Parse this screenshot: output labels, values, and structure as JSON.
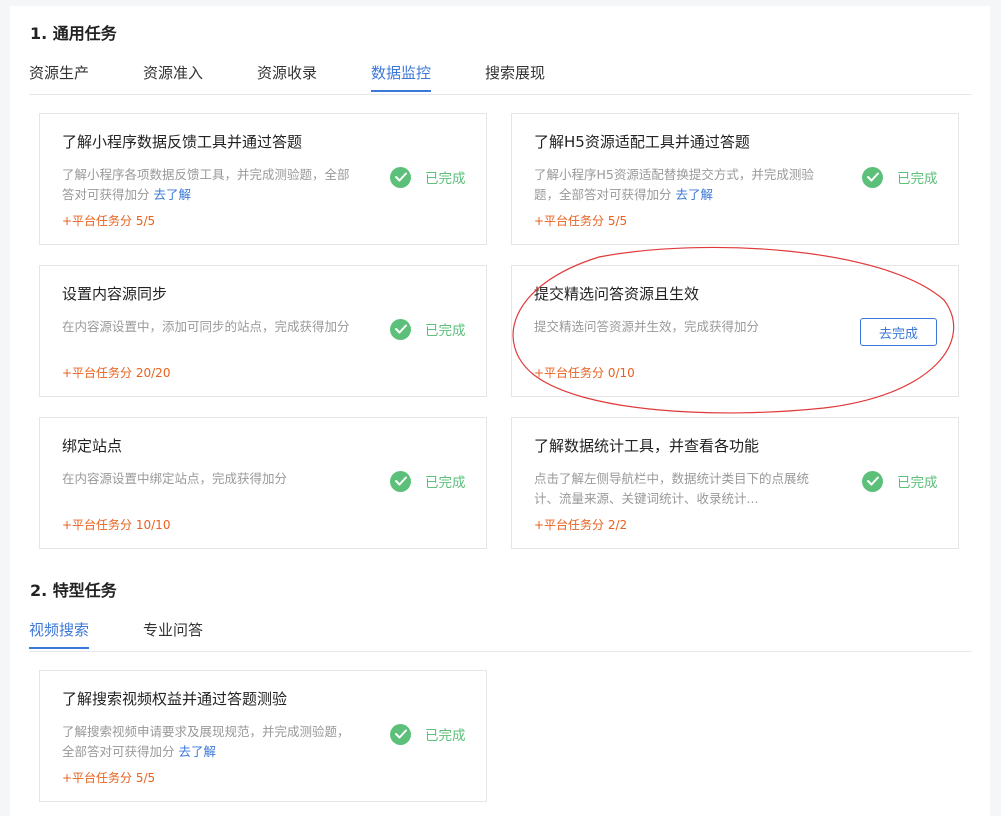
{
  "section1": {
    "title": "1. 通用任务",
    "tabs": [
      "资源生产",
      "资源准入",
      "资源收录",
      "数据监控",
      "搜索展现"
    ],
    "active_tab": "数据监控"
  },
  "section2": {
    "title": "2. 特型任务",
    "tabs": [
      "视频搜索",
      "专业问答"
    ],
    "active_tab": "视频搜索"
  },
  "status_completed": "已完成",
  "go_complete_label": "去完成",
  "cards": [
    {
      "title": "了解小程序数据反馈工具并通过答题",
      "desc": "了解小程序各项数据反馈工具，并完成测验题，全部答对可获得加分",
      "link": "去了解",
      "score": "+平台任务分 5/5",
      "status": "completed"
    },
    {
      "title": "了解H5资源适配工具并通过答题",
      "desc": "了解小程序H5资源适配替换提交方式，并完成测验题，全部答对可获得加分",
      "link": "去了解",
      "score": "+平台任务分 5/5",
      "status": "completed"
    },
    {
      "title": "设置内容源同步",
      "desc": "在内容源设置中，添加可同步的站点，完成获得加分",
      "link": "",
      "score": "+平台任务分 20/20",
      "status": "completed"
    },
    {
      "title": "提交精选问答资源且生效",
      "desc": "提交精选问答资源并生效，完成获得加分",
      "link": "",
      "score": "+平台任务分 0/10",
      "status": "pending"
    },
    {
      "title": "绑定站点",
      "desc": "在内容源设置中绑定站点，完成获得加分",
      "link": "",
      "score": "+平台任务分 10/10",
      "status": "completed"
    },
    {
      "title": "了解数据统计工具，并查看各功能",
      "desc": "点击了解左侧导航栏中，数据统计类目下的点展统计、流量来源、关键词统计、收录统计...",
      "link": "",
      "score": "+平台任务分 2/2",
      "status": "completed"
    },
    {
      "title": "了解搜索视频权益并通过答题测验",
      "desc": "了解搜索视频申请要求及展现规范，并完成测验题，全部答对可获得加分",
      "link": "去了解",
      "score": "+平台任务分 5/5",
      "status": "completed"
    }
  ],
  "colors": {
    "accent": "#3c78d8",
    "success": "#5cc07a",
    "score": "#e8611e",
    "annotation": "#e03a3a"
  }
}
